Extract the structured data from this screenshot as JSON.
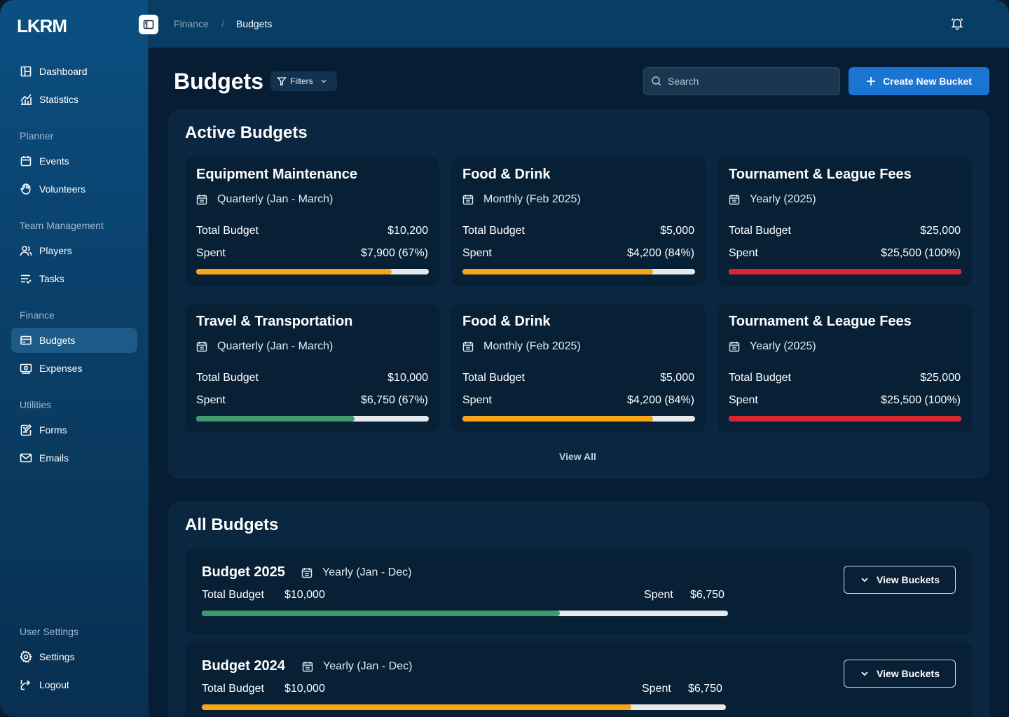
{
  "brand": "LKRM",
  "breadcrumb": [
    "Finance",
    "Budgets"
  ],
  "sidebar": {
    "top": [
      {
        "label": "Dashboard",
        "icon": "dashboard-icon"
      },
      {
        "label": "Statistics",
        "icon": "statistics-icon"
      }
    ],
    "sections": [
      {
        "title": "Planner",
        "items": [
          {
            "label": "Events",
            "icon": "calendar-icon"
          },
          {
            "label": "Volunteers",
            "icon": "hand-icon"
          }
        ]
      },
      {
        "title": "Team Management",
        "items": [
          {
            "label": "Players",
            "icon": "users-icon"
          },
          {
            "label": "Tasks",
            "icon": "tasks-icon"
          }
        ]
      },
      {
        "title": "Finance",
        "items": [
          {
            "label": "Budgets",
            "icon": "wallet-icon",
            "active": true
          },
          {
            "label": "Expenses",
            "icon": "expenses-icon"
          }
        ]
      },
      {
        "title": "Utilities",
        "items": [
          {
            "label": "Forms",
            "icon": "forms-icon"
          },
          {
            "label": "Emails",
            "icon": "mail-icon"
          }
        ]
      },
      {
        "title": "User Settings",
        "items": [
          {
            "label": "Settings",
            "icon": "gear-icon"
          },
          {
            "label": "Logout",
            "icon": "logout-icon"
          }
        ]
      }
    ]
  },
  "header": {
    "title": "Budgets",
    "filters_label": "Filters",
    "search_placeholder": "Search",
    "create_label": "Create New Bucket"
  },
  "active": {
    "title": "Active Budgets",
    "view_all": "View All",
    "total_label": "Total Budget",
    "spent_label": "Spent",
    "cards": [
      {
        "title": "Equipment Maintenance",
        "period": "Quarterly (Jan - March)",
        "total": "$10,200",
        "spent": "$7,900 (67%)",
        "progress": 0.84,
        "color": "#f5a516"
      },
      {
        "title": "Food & Drink",
        "period": "Monthly (Feb 2025)",
        "total": "$5,000",
        "spent": "$4,200 (84%)",
        "progress": 0.82,
        "color": "#f5a516"
      },
      {
        "title": "Tournament & League Fees",
        "period": "Yearly (2025)",
        "total": "$25,000",
        "spent": "$25,500 (100%)",
        "progress": 1.0,
        "color": "#d92433"
      },
      {
        "title": "Travel & Transportation",
        "period": "Quarterly (Jan - March)",
        "total": "$10,000",
        "spent": "$6,750 (67%)",
        "progress": 0.68,
        "color": "#3f9a6c"
      },
      {
        "title": "Food & Drink",
        "period": "Monthly (Feb 2025)",
        "total": "$5,000",
        "spent": "$4,200 (84%)",
        "progress": 0.82,
        "color": "#f5a516"
      },
      {
        "title": "Tournament & League Fees",
        "period": "Yearly (2025)",
        "total": "$25,000",
        "spent": "$25,500 (100%)",
        "progress": 1.0,
        "color": "#d92433"
      }
    ]
  },
  "all": {
    "title": "All Budgets",
    "total_label": "Total Budget",
    "spent_label": "Spent",
    "button_label": "View Buckets",
    "rows": [
      {
        "title": "Budget 2025",
        "period": "Yearly (Jan - Dec)",
        "total": "$10,000",
        "spent": "$6,750",
        "progress": 0.68,
        "color": "#3f9a6c"
      },
      {
        "title": "Budget 2024",
        "period": "Yearly (Jan - Dec)",
        "total": "$10,000",
        "spent": "$6,750",
        "progress": 0.82,
        "color": "#f5a516"
      }
    ]
  }
}
